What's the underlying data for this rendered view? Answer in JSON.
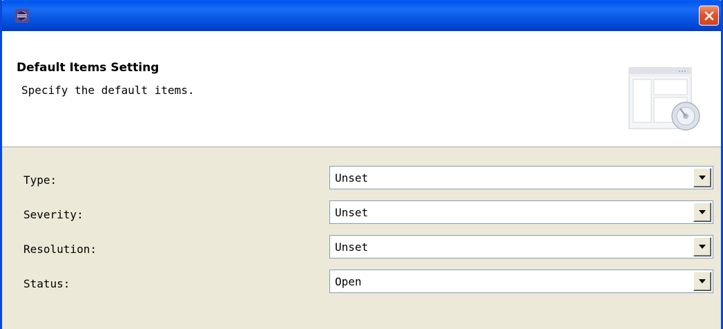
{
  "header": {
    "title": "Default Items Setting",
    "description": "Specify the default items."
  },
  "fields": [
    {
      "label": "Type:",
      "value": "Unset"
    },
    {
      "label": "Severity:",
      "value": "Unset"
    },
    {
      "label": "Resolution:",
      "value": "Unset"
    },
    {
      "label": "Status:",
      "value": "Open"
    }
  ],
  "icons": {
    "app": "eclipse-icon",
    "close": "close-icon",
    "wizard": "wizard-banner-graphic",
    "dropdown": "chevron-down-icon"
  },
  "colors": {
    "titlebar": "#0a5ae6",
    "close_button": "#e2532c",
    "dialog_background": "#ece9d8",
    "banner_background": "#ffffff"
  }
}
